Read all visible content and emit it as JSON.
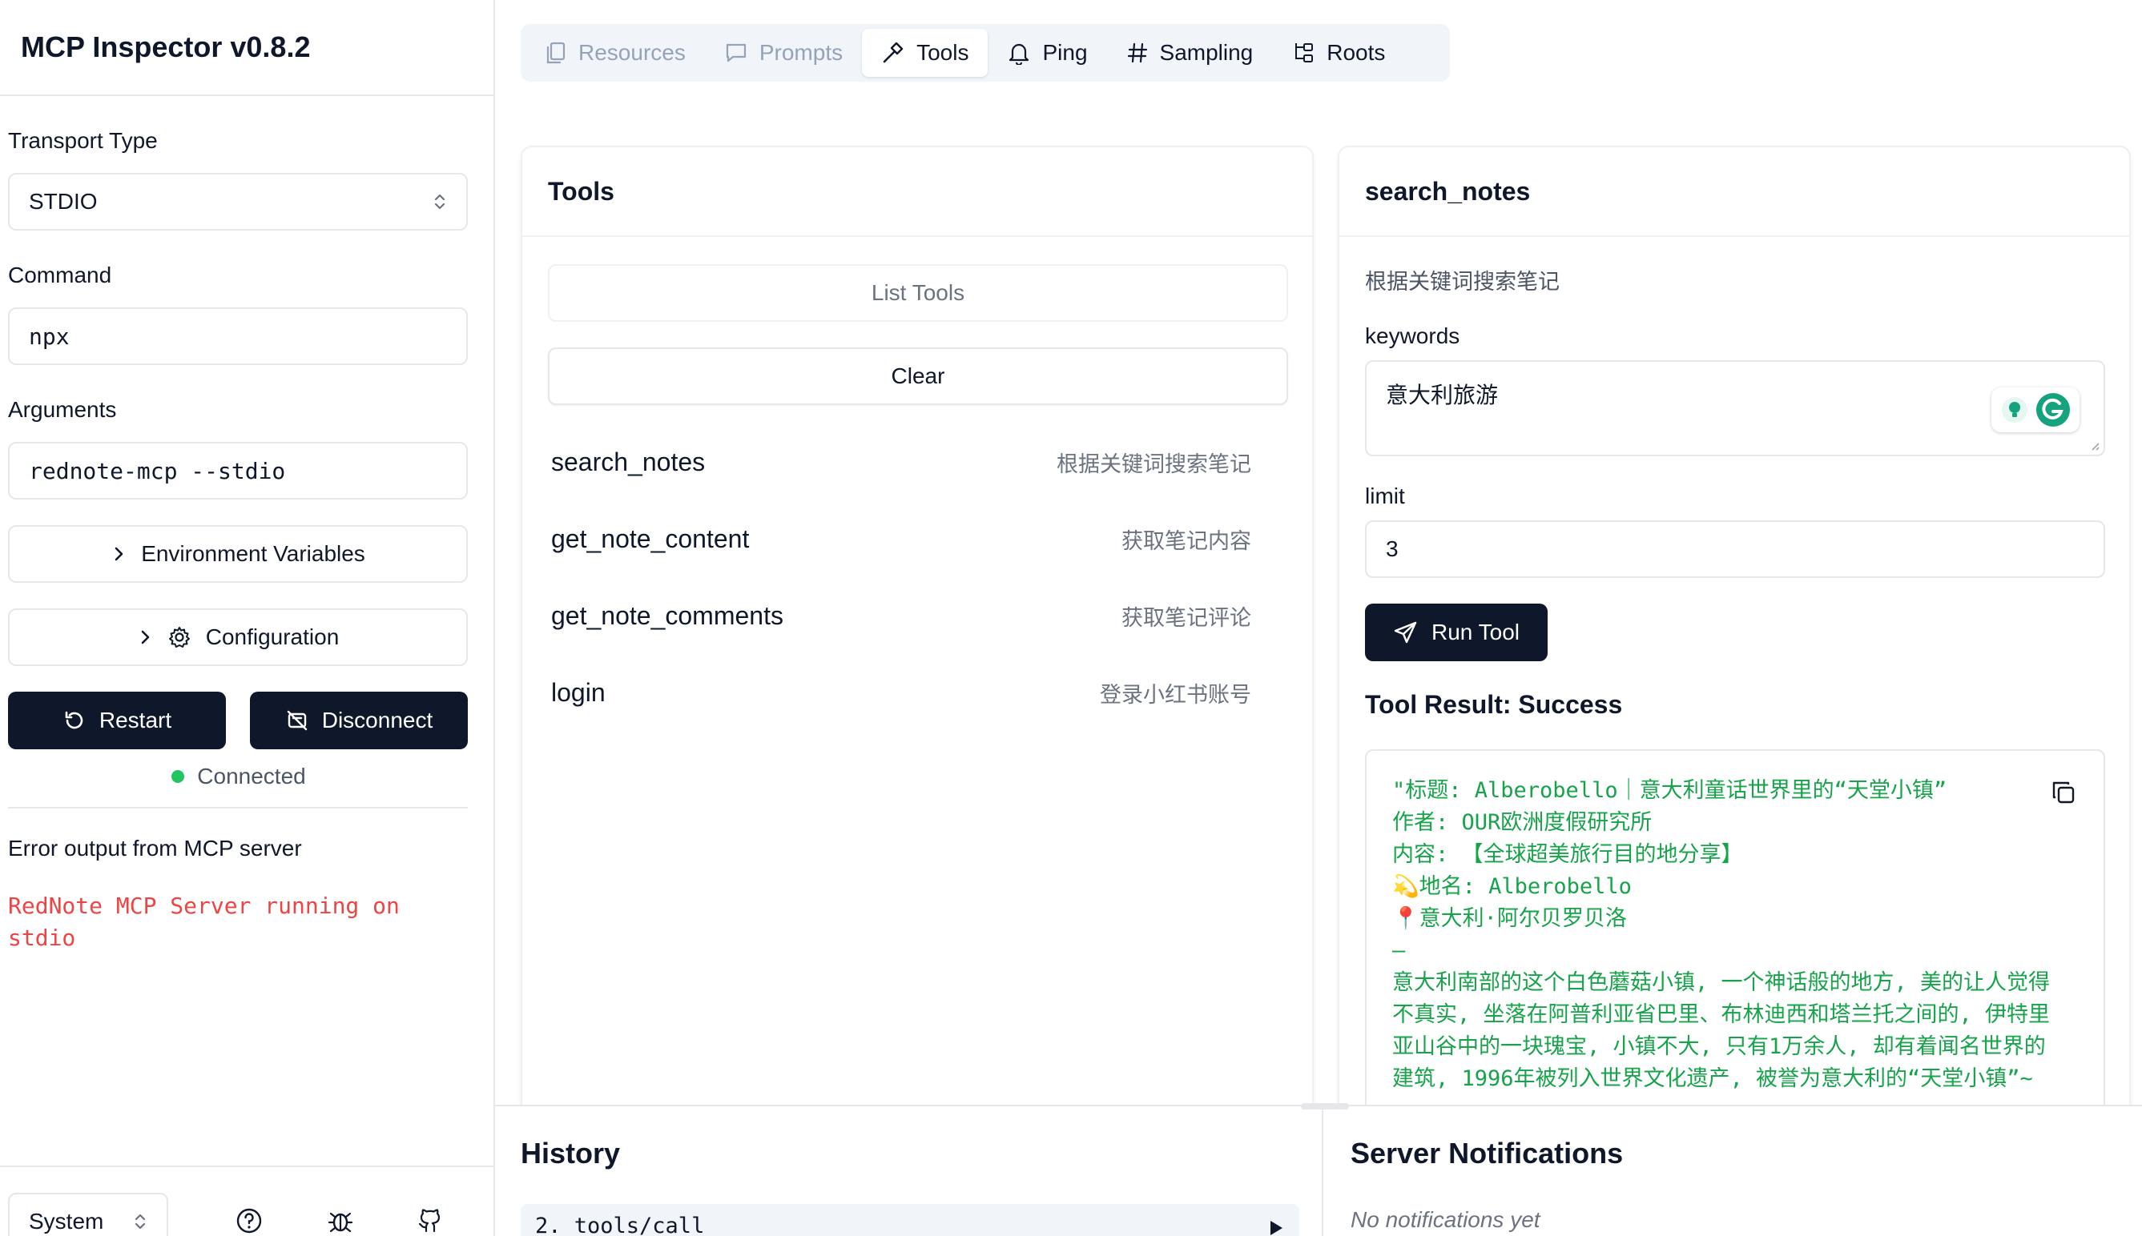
{
  "app": {
    "title": "MCP Inspector v0.8.2"
  },
  "sidebar": {
    "transport_label": "Transport Type",
    "transport_value": "STDIO",
    "command_label": "Command",
    "command_value": "npx",
    "arguments_label": "Arguments",
    "arguments_value": "rednote-mcp --stdio",
    "env_button": "Environment Variables",
    "config_button": "Configuration",
    "restart_button": "Restart",
    "disconnect_button": "Disconnect",
    "status": "Connected",
    "status_color": "#22c55e",
    "error_title": "Error output from MCP server",
    "error_text": "RedNote MCP Server running on stdio",
    "error_color": "#ef4444",
    "theme_value": "System",
    "footer_icons": [
      "help-icon",
      "bug-icon",
      "github-icon"
    ]
  },
  "tabs": [
    {
      "label": "Resources",
      "icon": "resources-icon",
      "state": "disabled"
    },
    {
      "label": "Prompts",
      "icon": "message-icon",
      "state": "disabled"
    },
    {
      "label": "Tools",
      "icon": "hammer-icon",
      "state": "active"
    },
    {
      "label": "Ping",
      "icon": "bell-icon",
      "state": "normal"
    },
    {
      "label": "Sampling",
      "icon": "hash-icon",
      "state": "normal"
    },
    {
      "label": "Roots",
      "icon": "folder-tree-icon",
      "state": "normal"
    }
  ],
  "tools_panel": {
    "title": "Tools",
    "list_button": "List Tools",
    "clear_button": "Clear",
    "items": [
      {
        "name": "search_notes",
        "desc": "根据关键词搜索笔记"
      },
      {
        "name": "get_note_content",
        "desc": "获取笔记内容"
      },
      {
        "name": "get_note_comments",
        "desc": "获取笔记评论"
      },
      {
        "name": "login",
        "desc": "登录小红书账号"
      }
    ]
  },
  "detail_panel": {
    "title": "search_notes",
    "description": "根据关键词搜索笔记",
    "keywords_label": "keywords",
    "keywords_value": "意大利旅游",
    "limit_label": "limit",
    "limit_value": "3",
    "run_button": "Run Tool",
    "result_title": "Tool Result: Success",
    "result_lines": [
      "\"标题: Alberobello｜意大利童话世界里的“天堂小镇”",
      "作者: OUR欧洲度假研究所",
      "内容: 【全球超美旅行目的地分享】",
      "💫地名: Alberobello",
      "📍意大利·阿尔贝罗贝洛",
      "—",
      "意大利南部的这个白色蘑菇小镇, 一个神话般的地方, 美的让人觉得",
      "不真实, 坐落在阿普利亚省巴里、布林迪西和塔兰托之间的, 伊特里",
      "亚山谷中的一块瑰宝, 小镇不大, 只有1万余人, 却有着闻名世界的",
      "建筑, 1996年被列入世界文化遗产, 被誉为意大利的“天堂小镇”~"
    ],
    "result_color": "#16a34a"
  },
  "history": {
    "title": "History",
    "item": "2. tools/call"
  },
  "notifications": {
    "title": "Server Notifications",
    "empty": "No notifications yet"
  }
}
